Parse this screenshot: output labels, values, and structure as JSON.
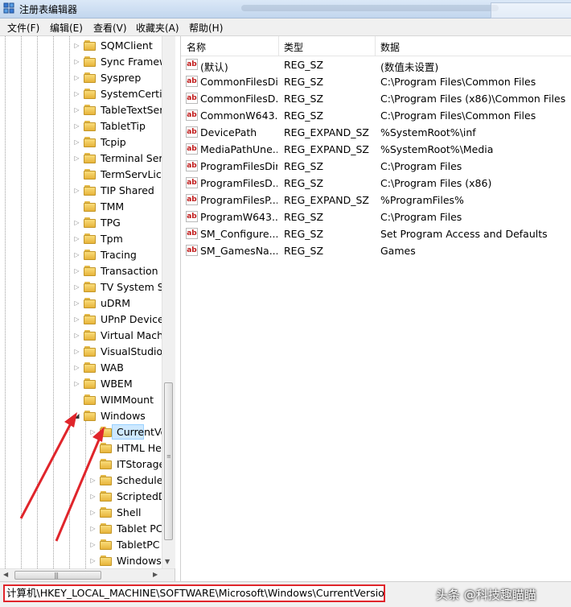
{
  "window": {
    "title": "注册表编辑器"
  },
  "menu": [
    "文件(F)",
    "编辑(E)",
    "查看(V)",
    "收藏夹(A)",
    "帮助(H)"
  ],
  "tree": {
    "items": [
      {
        "label": "SQMClient",
        "depth": 0,
        "expander": "▷"
      },
      {
        "label": "Sync Framew",
        "depth": 0,
        "expander": "▷"
      },
      {
        "label": "Sysprep",
        "depth": 0,
        "expander": "▷"
      },
      {
        "label": "SystemCertifi",
        "depth": 0,
        "expander": "▷"
      },
      {
        "label": "TableTextSer",
        "depth": 0,
        "expander": "▷"
      },
      {
        "label": "TabletTip",
        "depth": 0,
        "expander": "▷"
      },
      {
        "label": "Tcpip",
        "depth": 0,
        "expander": "▷"
      },
      {
        "label": "Terminal Serv",
        "depth": 0,
        "expander": "▷"
      },
      {
        "label": "TermServLice",
        "depth": 0,
        "expander": ""
      },
      {
        "label": "TIP Shared",
        "depth": 0,
        "expander": "▷"
      },
      {
        "label": "TMM",
        "depth": 0,
        "expander": ""
      },
      {
        "label": "TPG",
        "depth": 0,
        "expander": "▷"
      },
      {
        "label": "Tpm",
        "depth": 0,
        "expander": "▷"
      },
      {
        "label": "Tracing",
        "depth": 0,
        "expander": "▷"
      },
      {
        "label": "Transaction S",
        "depth": 0,
        "expander": "▷"
      },
      {
        "label": "TV System Se",
        "depth": 0,
        "expander": "▷"
      },
      {
        "label": "uDRM",
        "depth": 0,
        "expander": "▷"
      },
      {
        "label": "UPnP Device",
        "depth": 0,
        "expander": "▷"
      },
      {
        "label": "Virtual Machi",
        "depth": 0,
        "expander": "▷"
      },
      {
        "label": "VisualStudio",
        "depth": 0,
        "expander": "▷"
      },
      {
        "label": "WAB",
        "depth": 0,
        "expander": "▷"
      },
      {
        "label": "WBEM",
        "depth": 0,
        "expander": "▷"
      },
      {
        "label": "WIMMount",
        "depth": 0,
        "expander": ""
      },
      {
        "label": "Windows",
        "depth": 0,
        "expander": "◢"
      },
      {
        "label": "CurrentVe",
        "depth": 1,
        "expander": "▷",
        "selected": true
      },
      {
        "label": "HTML Hel",
        "depth": 1,
        "expander": ""
      },
      {
        "label": "ITStorage",
        "depth": 1,
        "expander": ""
      },
      {
        "label": "Schedulec",
        "depth": 1,
        "expander": "▷"
      },
      {
        "label": "ScriptedD",
        "depth": 1,
        "expander": "▷"
      },
      {
        "label": "Shell",
        "depth": 1,
        "expander": "▷"
      },
      {
        "label": "Tablet PC",
        "depth": 1,
        "expander": "▷"
      },
      {
        "label": "TabletPC",
        "depth": 1,
        "expander": "▷"
      },
      {
        "label": "Windows",
        "depth": 1,
        "expander": "▷"
      }
    ]
  },
  "list": {
    "columns": [
      "名称",
      "类型",
      "数据"
    ],
    "rows": [
      {
        "name": "(默认)",
        "type": "REG_SZ",
        "data": "(数值未设置)"
      },
      {
        "name": "CommonFilesDir",
        "type": "REG_SZ",
        "data": "C:\\Program Files\\Common Files"
      },
      {
        "name": "CommonFilesD...",
        "type": "REG_SZ",
        "data": "C:\\Program Files (x86)\\Common Files"
      },
      {
        "name": "CommonW643...",
        "type": "REG_SZ",
        "data": "C:\\Program Files\\Common Files"
      },
      {
        "name": "DevicePath",
        "type": "REG_EXPAND_SZ",
        "data": "%SystemRoot%\\inf"
      },
      {
        "name": "MediaPathUne...",
        "type": "REG_EXPAND_SZ",
        "data": "%SystemRoot%\\Media"
      },
      {
        "name": "ProgramFilesDir",
        "type": "REG_SZ",
        "data": "C:\\Program Files"
      },
      {
        "name": "ProgramFilesD...",
        "type": "REG_SZ",
        "data": "C:\\Program Files (x86)"
      },
      {
        "name": "ProgramFilesP...",
        "type": "REG_EXPAND_SZ",
        "data": "%ProgramFiles%"
      },
      {
        "name": "ProgramW643...",
        "type": "REG_SZ",
        "data": "C:\\Program Files"
      },
      {
        "name": "SM_Configure...",
        "type": "REG_SZ",
        "data": "Set Program Access and Defaults"
      },
      {
        "name": "SM_GamesNa...",
        "type": "REG_SZ",
        "data": "Games"
      }
    ],
    "value_icon": "ab"
  },
  "status": {
    "path": "计算机\\HKEY_LOCAL_MACHINE\\SOFTWARE\\Microsoft\\Windows\\CurrentVersion",
    "watermark": "头条 @科技趣瞄瞄"
  },
  "colors": {
    "highlight_red": "#e0252b",
    "selection": "#cde8ff",
    "folder": "#f2c75c"
  },
  "icons": {
    "app": "registry-editor-icon",
    "folder": "folder-icon",
    "value": "string-value-icon",
    "expand": "triangle-right-icon",
    "collapse": "triangle-down-icon"
  }
}
